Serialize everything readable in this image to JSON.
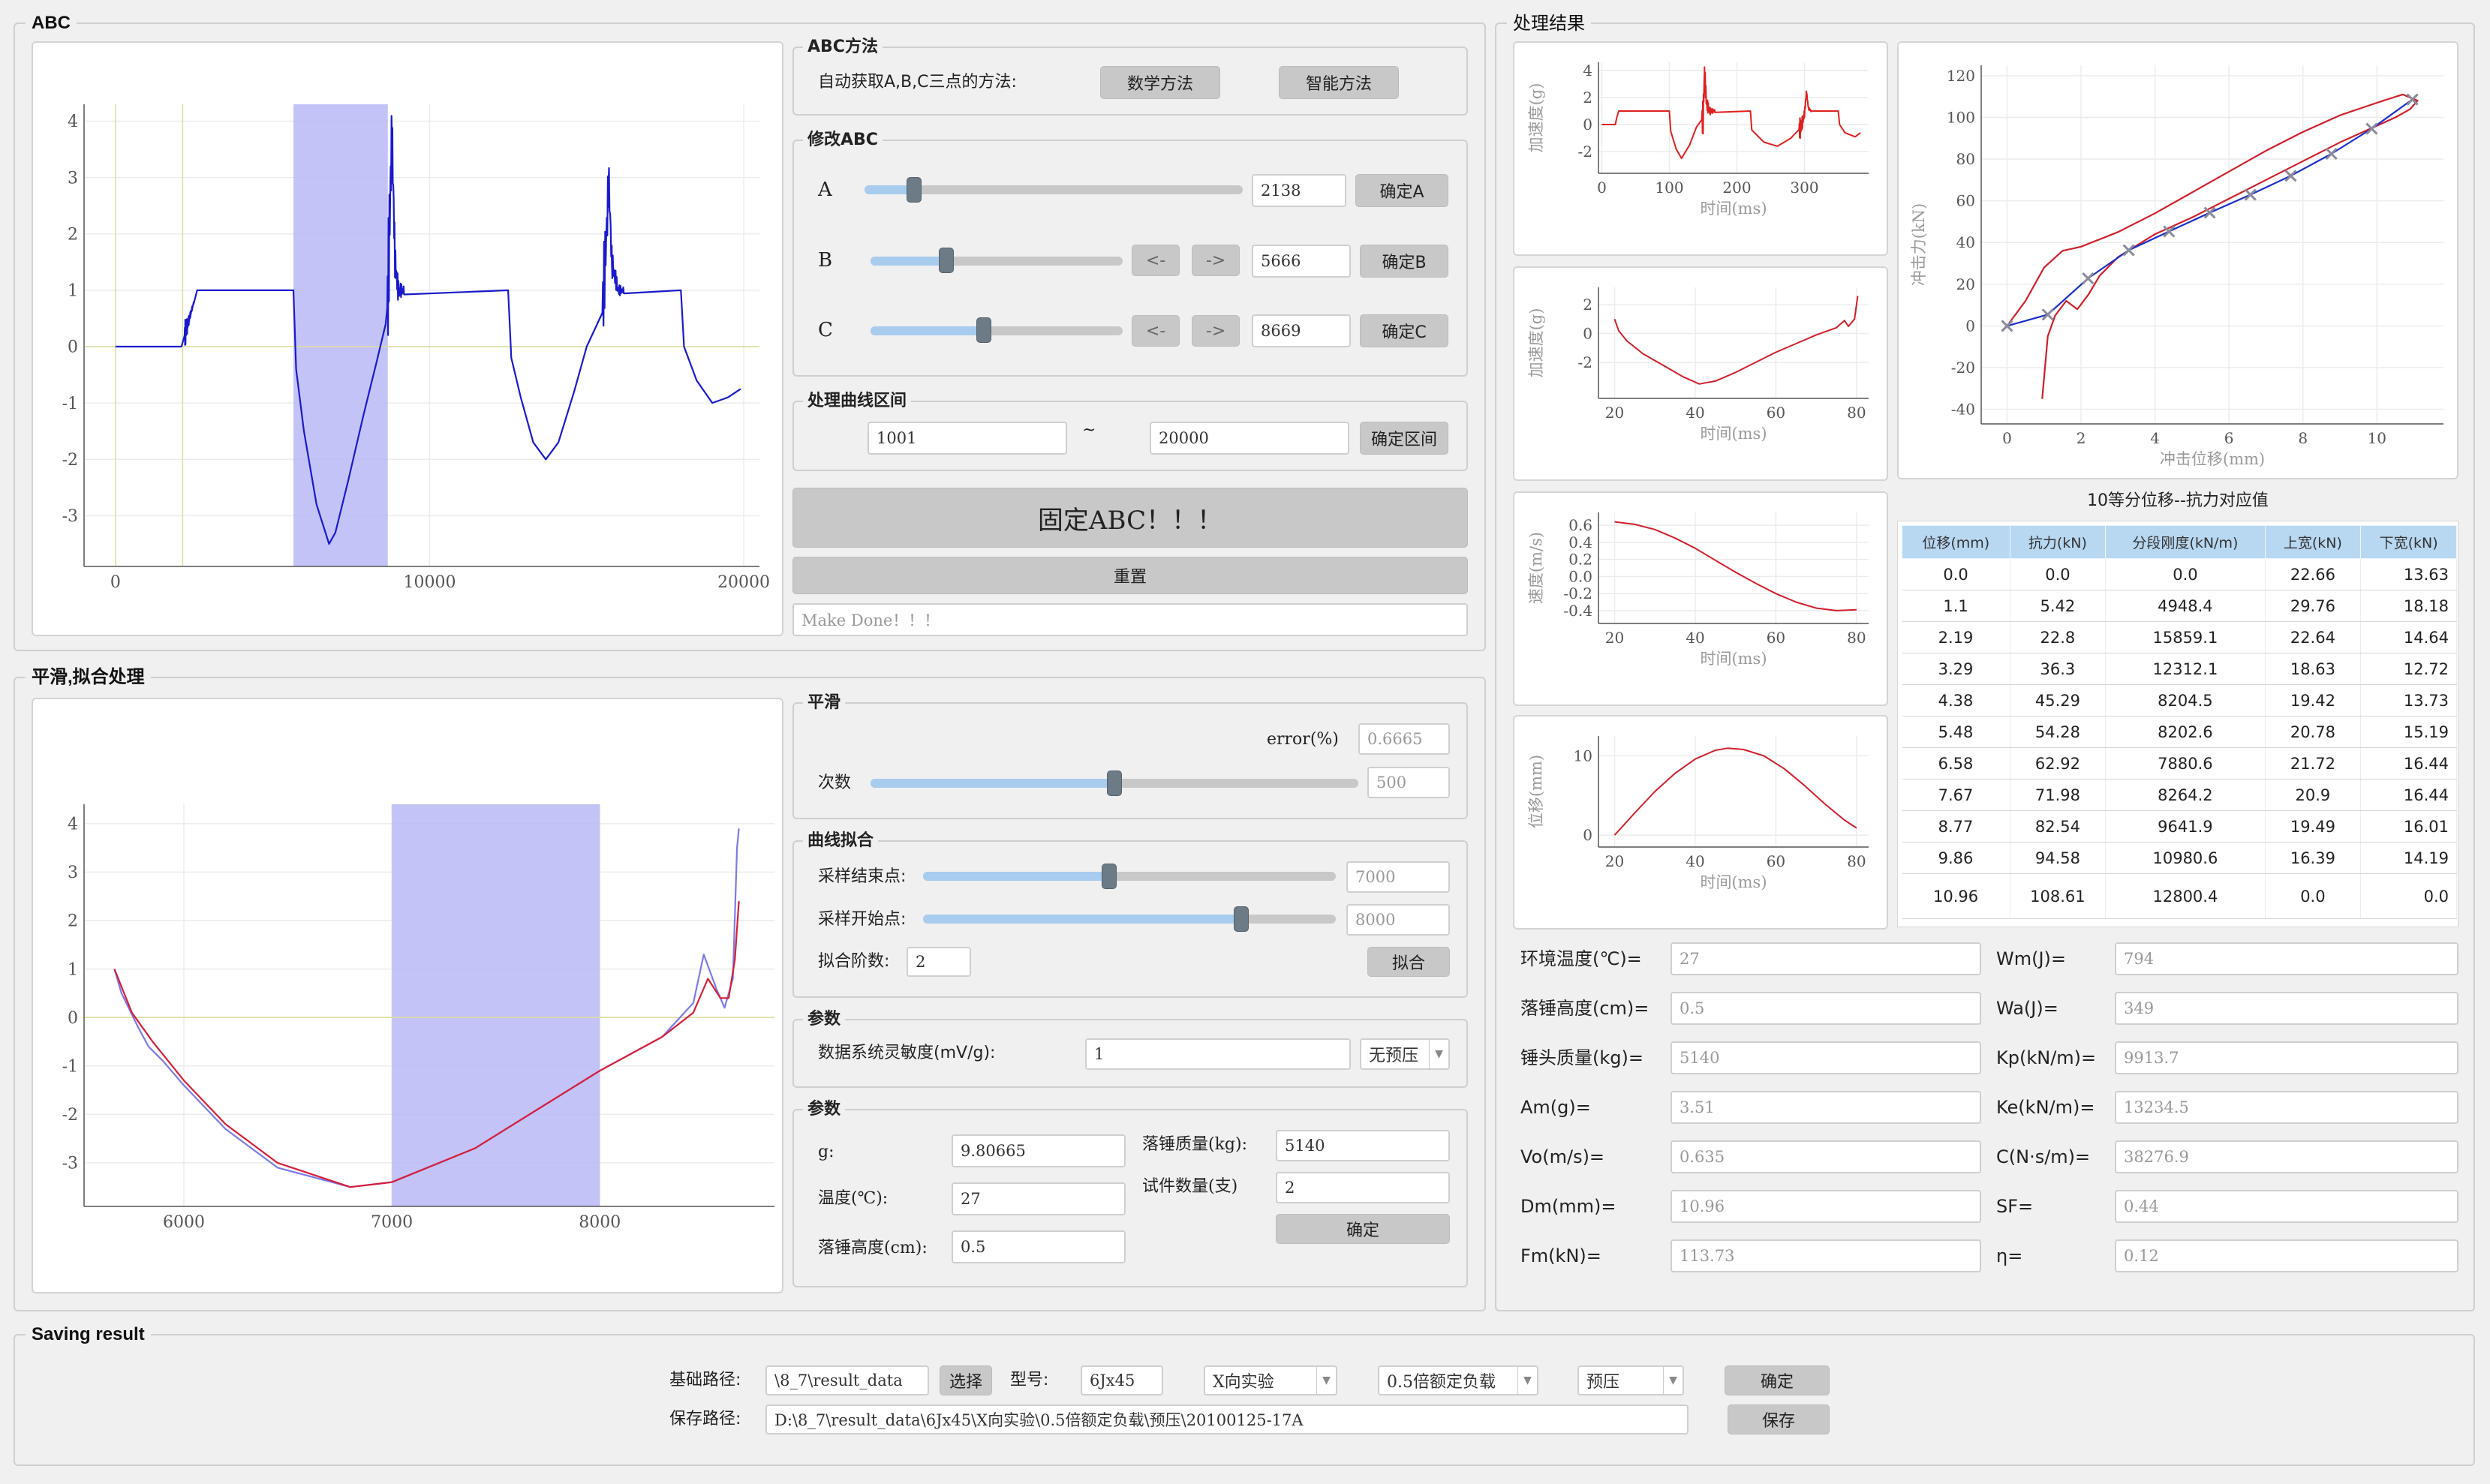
{
  "groups": {
    "abc": "ABC",
    "smooth": "平滑,拟合处理",
    "result": "处理结果",
    "saving": "Saving result"
  },
  "abc_method": {
    "title": "ABC方法",
    "desc": "自动获取A,B,C三点的方法:",
    "math_btn": "数学方法",
    "smart_btn": "智能方法"
  },
  "modify_abc": {
    "title": "修改ABC",
    "rows": [
      {
        "label": "A",
        "value": "2138",
        "confirm": "确定A",
        "level": 0.13
      },
      {
        "label": "B",
        "value": "5666",
        "confirm": "确定B",
        "level": 0.3
      },
      {
        "label": "C",
        "value": "8669",
        "confirm": "确定C",
        "level": 0.45
      }
    ],
    "left": "<-",
    "right": "->"
  },
  "range": {
    "title": "处理曲线区间",
    "start": "1001",
    "sep": "~",
    "end": "20000",
    "confirm": "确定区间"
  },
  "fix_btn": "固定ABC！！！",
  "reset_btn": "重置",
  "status_text": "Make Done！！！",
  "smooth": {
    "title": "平滑",
    "error_label": "error(%)",
    "error_value": "0.6665",
    "count_label": "次数",
    "count_value": "500",
    "count_level": 0.5
  },
  "fit": {
    "title": "曲线拟合",
    "end_label": "采样结束点:",
    "end_value": "7000",
    "end_level": 0.45,
    "start_label": "采样开始点:",
    "start_value": "8000",
    "start_level": 0.77,
    "order_label": "拟合阶数:",
    "order_value": "2",
    "fit_btn": "拟合"
  },
  "params1": {
    "title": "参数",
    "sens_label": "数据系统灵敏度(mV/g):",
    "sens_value": "1",
    "preload": "无预压"
  },
  "params2": {
    "title": "参数",
    "g_label": "g:",
    "g_value": "9.80665",
    "temp_label": "温度(℃):",
    "temp_value": "27",
    "height_label": "落锤高度(cm):",
    "height_value": "0.5",
    "mass_label": "落锤质量(kg):",
    "mass_value": "5140",
    "count_label": "试件数量(支)",
    "count_value": "2",
    "confirm": "确定"
  },
  "results_table": {
    "title": "10等分位移--抗力对应值",
    "headers": [
      "位移(mm)",
      "抗力(kN)",
      "分段刚度(kN/m)",
      "上宽(kN)",
      "下宽(kN)"
    ],
    "rows": [
      [
        "0.0",
        "0.0",
        "0.0",
        "22.66",
        "13.63"
      ],
      [
        "1.1",
        "5.42",
        "4948.4",
        "29.76",
        "18.18"
      ],
      [
        "2.19",
        "22.8",
        "15859.1",
        "22.64",
        "14.64"
      ],
      [
        "3.29",
        "36.3",
        "12312.1",
        "18.63",
        "12.72"
      ],
      [
        "4.38",
        "45.29",
        "8204.5",
        "19.42",
        "13.73"
      ],
      [
        "5.48",
        "54.28",
        "8202.6",
        "20.78",
        "15.19"
      ],
      [
        "6.58",
        "62.92",
        "7880.6",
        "21.72",
        "16.44"
      ],
      [
        "7.67",
        "71.98",
        "8264.2",
        "20.9",
        "16.44"
      ],
      [
        "8.77",
        "82.54",
        "9641.9",
        "19.49",
        "16.01"
      ],
      [
        "9.86",
        "94.58",
        "10980.6",
        "16.39",
        "14.19"
      ],
      [
        "10.96",
        "108.61",
        "12800.4",
        "0.0",
        "0.0"
      ]
    ]
  },
  "results_fields": {
    "left": [
      {
        "label": "环境温度(℃)=",
        "value": "27"
      },
      {
        "label": "落锤高度(cm)=",
        "value": "0.5"
      },
      {
        "label": "锤头质量(kg)=",
        "value": "5140"
      },
      {
        "label": "Am(g)=",
        "value": "3.51"
      },
      {
        "label": "Vo(m/s)=",
        "value": "0.635"
      },
      {
        "label": "Dm(mm)=",
        "value": "10.96"
      },
      {
        "label": "Fm(kN)=",
        "value": "113.73"
      }
    ],
    "right": [
      {
        "label": "Wm(J)=",
        "value": "794"
      },
      {
        "label": "Wa(J)=",
        "value": "349"
      },
      {
        "label": "Kp(kN/m)=",
        "value": "9913.7"
      },
      {
        "label": "Ke(kN/m)=",
        "value": "13234.5"
      },
      {
        "label": "C(N·s/m)=",
        "value": "38276.9"
      },
      {
        "label": "SF=",
        "value": "0.44"
      },
      {
        "label": "η=",
        "value": "0.12"
      }
    ]
  },
  "saving": {
    "base_label": "基础路径:",
    "base_value": "\\8_7\\result_data",
    "choose_btn": "选择",
    "model_label": "型号:",
    "model_value": "6Jx45",
    "direction": "X向实验",
    "load": "0.5倍额定负载",
    "preload": "预压",
    "confirm_btn": "确定",
    "save_label": "保存路径:",
    "save_value": "D:\\8_7\\result_data\\6Jx45\\X向实验\\0.5倍额定负载\\预压\\20100125-17A",
    "save_btn": "保存"
  },
  "chart_data": [
    {
      "id": "abc_signal",
      "type": "line",
      "title": "",
      "xlabel": "",
      "ylabel": "",
      "xlim": [
        -1000,
        20500
      ],
      "ylim": [
        -3.9,
        4.3
      ],
      "xticks": [
        0,
        10000,
        20000
      ],
      "yticks": [
        -3,
        -2,
        -1,
        0,
        1,
        2,
        3,
        4
      ],
      "highlight": [
        5666,
        8669
      ],
      "vlines": [
        0,
        2138
      ],
      "color": "#1a1acd",
      "points": [
        [
          0,
          0
        ],
        [
          2100,
          0
        ],
        [
          2300,
          0.4
        ],
        [
          2600,
          1.0
        ],
        [
          5666,
          1.0
        ],
        [
          5750,
          -0.4
        ],
        [
          6000,
          -1.5
        ],
        [
          6400,
          -2.8
        ],
        [
          6800,
          -3.5
        ],
        [
          7000,
          -3.3
        ],
        [
          7400,
          -2.4
        ],
        [
          7900,
          -1.2
        ],
        [
          8300,
          -0.3
        ],
        [
          8600,
          0.4
        ],
        [
          8669,
          0.8
        ],
        [
          8730,
          2.3
        ],
        [
          8800,
          3.8
        ],
        [
          8900,
          1.5
        ],
        [
          9000,
          1.0
        ],
        [
          12500,
          1.0
        ],
        [
          12600,
          -0.2
        ],
        [
          12900,
          -0.9
        ],
        [
          13300,
          -1.7
        ],
        [
          13700,
          -2.0
        ],
        [
          14100,
          -1.7
        ],
        [
          14600,
          -0.8
        ],
        [
          15000,
          0
        ],
        [
          15500,
          0.6
        ],
        [
          15650,
          2.2
        ],
        [
          15700,
          3.0
        ],
        [
          15800,
          1.5
        ],
        [
          16000,
          1.0
        ],
        [
          18000,
          1.0
        ],
        [
          18100,
          0
        ],
        [
          18500,
          -0.6
        ],
        [
          19000,
          -1.0
        ],
        [
          19500,
          -0.9
        ],
        [
          19900,
          -0.75
        ]
      ],
      "noise": [
        [
          2200,
          2500,
          0.3
        ],
        [
          8650,
          9200,
          1.2
        ],
        [
          15500,
          16200,
          0.9
        ]
      ]
    },
    {
      "id": "smooth_fit",
      "type": "line",
      "title": "",
      "xlabel": "",
      "ylabel": "",
      "xlim": [
        5520,
        8840
      ],
      "ylim": [
        -3.9,
        4.4
      ],
      "xticks": [
        6000,
        7000,
        8000
      ],
      "yticks": [
        -3,
        -2,
        -1,
        0,
        1,
        2,
        3,
        4
      ],
      "highlight": [
        7000,
        8000
      ],
      "series": [
        {
          "color": "#7b7be8",
          "points": [
            [
              5666,
              1.0
            ],
            [
              5700,
              0.5
            ],
            [
              5780,
              -0.2
            ],
            [
              5830,
              -0.6
            ],
            [
              5900,
              -0.9
            ],
            [
              6000,
              -1.4
            ],
            [
              6200,
              -2.3
            ],
            [
              6450,
              -3.1
            ],
            [
              6800,
              -3.5
            ],
            [
              7000,
              -3.4
            ],
            [
              7400,
              -2.7
            ],
            [
              7700,
              -1.9
            ],
            [
              8000,
              -1.1
            ],
            [
              8300,
              -0.4
            ],
            [
              8450,
              0.3
            ],
            [
              8500,
              1.3
            ],
            [
              8560,
              0.6
            ],
            [
              8600,
              0.2
            ],
            [
              8640,
              0.8
            ],
            [
              8660,
              3.5
            ],
            [
              8669,
              3.9
            ]
          ]
        },
        {
          "color": "#d61f3a",
          "points": [
            [
              5666,
              1.0
            ],
            [
              5750,
              0.1
            ],
            [
              5850,
              -0.5
            ],
            [
              6000,
              -1.3
            ],
            [
              6200,
              -2.2
            ],
            [
              6450,
              -3.0
            ],
            [
              6800,
              -3.5
            ],
            [
              7000,
              -3.4
            ],
            [
              7400,
              -2.7
            ],
            [
              7700,
              -1.9
            ],
            [
              8000,
              -1.1
            ],
            [
              8300,
              -0.4
            ],
            [
              8450,
              0.1
            ],
            [
              8520,
              0.8
            ],
            [
              8580,
              0.4
            ],
            [
              8620,
              0.4
            ],
            [
              8650,
              1.2
            ],
            [
              8669,
              2.4
            ]
          ]
        }
      ]
    },
    {
      "id": "accel_full",
      "type": "line",
      "xlabel": "时间(ms)",
      "ylabel": "加速度(g)",
      "xlim": [
        -5,
        395
      ],
      "ylim": [
        -3.6,
        4.6
      ],
      "xticks": [
        0,
        100,
        200,
        300
      ],
      "yticks": [
        -2,
        0,
        2,
        4
      ],
      "color": "#e02020",
      "points": [
        [
          0,
          0
        ],
        [
          20,
          0
        ],
        [
          22,
          0.5
        ],
        [
          25,
          1
        ],
        [
          100,
          1
        ],
        [
          102,
          -0.5
        ],
        [
          110,
          -1.8
        ],
        [
          118,
          -2.5
        ],
        [
          130,
          -1.5
        ],
        [
          140,
          -0.2
        ],
        [
          150,
          0.5
        ],
        [
          152,
          3.9
        ],
        [
          155,
          1.5
        ],
        [
          160,
          1
        ],
        [
          220,
          1
        ],
        [
          222,
          -0.4
        ],
        [
          240,
          -1.3
        ],
        [
          260,
          -1.6
        ],
        [
          280,
          -1.0
        ],
        [
          295,
          -0.2
        ],
        [
          300,
          0.8
        ],
        [
          303,
          2.4
        ],
        [
          306,
          1.2
        ],
        [
          310,
          1
        ],
        [
          350,
          1
        ],
        [
          352,
          0
        ],
        [
          360,
          -0.6
        ],
        [
          375,
          -0.9
        ],
        [
          383,
          -0.6
        ]
      ],
      "noise": [
        [
          148,
          168,
          1.6
        ],
        [
          292,
          310,
          1.0
        ]
      ]
    },
    {
      "id": "accel_seg",
      "type": "line",
      "xlabel": "时间(ms)",
      "ylabel": "加速度(g)",
      "xlim": [
        16,
        83
      ],
      "ylim": [
        -4.5,
        3.2
      ],
      "xticks": [
        20,
        40,
        60,
        80
      ],
      "yticks": [
        -2,
        0,
        2
      ],
      "color": "#d01f2c",
      "points": [
        [
          20,
          1.0
        ],
        [
          21,
          0.2
        ],
        [
          23,
          -0.5
        ],
        [
          27,
          -1.4
        ],
        [
          32,
          -2.2
        ],
        [
          37,
          -3.0
        ],
        [
          41,
          -3.5
        ],
        [
          45,
          -3.3
        ],
        [
          50,
          -2.7
        ],
        [
          55,
          -2.0
        ],
        [
          60,
          -1.3
        ],
        [
          65,
          -0.7
        ],
        [
          70,
          -0.1
        ],
        [
          75,
          0.4
        ],
        [
          77,
          0.9
        ],
        [
          78,
          0.5
        ],
        [
          79.5,
          1.0
        ],
        [
          80.3,
          2.6
        ]
      ]
    },
    {
      "id": "velocity",
      "type": "line",
      "xlabel": "时间(ms)",
      "ylabel": "速度(m/s)",
      "xlim": [
        16,
        83
      ],
      "ylim": [
        -0.55,
        0.75
      ],
      "xticks": [
        20,
        40,
        60,
        80
      ],
      "yticks": [
        -0.4,
        -0.2,
        0.0,
        0.2,
        0.4,
        0.6
      ],
      "color": "#d01f2c",
      "points": [
        [
          20,
          0.64
        ],
        [
          25,
          0.61
        ],
        [
          30,
          0.55
        ],
        [
          35,
          0.45
        ],
        [
          40,
          0.33
        ],
        [
          45,
          0.19
        ],
        [
          50,
          0.05
        ],
        [
          55,
          -0.08
        ],
        [
          60,
          -0.2
        ],
        [
          65,
          -0.3
        ],
        [
          70,
          -0.37
        ],
        [
          75,
          -0.4
        ],
        [
          80,
          -0.39
        ]
      ]
    },
    {
      "id": "displacement",
      "type": "line",
      "xlabel": "时间(ms)",
      "ylabel": "位移(mm)",
      "xlim": [
        16,
        83
      ],
      "ylim": [
        -1.5,
        12.5
      ],
      "xticks": [
        20,
        40,
        60,
        80
      ],
      "yticks": [
        0,
        10
      ],
      "color": "#d01f2c",
      "points": [
        [
          20,
          0
        ],
        [
          25,
          2.8
        ],
        [
          30,
          5.5
        ],
        [
          35,
          7.8
        ],
        [
          40,
          9.6
        ],
        [
          45,
          10.7
        ],
        [
          48,
          10.96
        ],
        [
          52,
          10.8
        ],
        [
          57,
          10.0
        ],
        [
          62,
          8.4
        ],
        [
          67,
          6.3
        ],
        [
          72,
          4.0
        ],
        [
          77,
          1.9
        ],
        [
          80,
          0.9
        ]
      ]
    },
    {
      "id": "force_disp",
      "type": "line",
      "xlabel": "冲击位移(mm)",
      "ylabel": "冲击力(kN)",
      "xlim": [
        -0.7,
        11.8
      ],
      "ylim": [
        -47,
        125
      ],
      "xticks": [
        0,
        2,
        4,
        6,
        8,
        10
      ],
      "yticks": [
        -40,
        -20,
        0,
        20,
        40,
        60,
        80,
        100,
        120
      ],
      "series": [
        {
          "name": "loop",
          "color": "#d01f2c",
          "points": [
            [
              0,
              0
            ],
            [
              0.5,
              12
            ],
            [
              1,
              28
            ],
            [
              1.5,
              36
            ],
            [
              2,
              38
            ],
            [
              3,
              45
            ],
            [
              4,
              54
            ],
            [
              5,
              64
            ],
            [
              6,
              74
            ],
            [
              7,
              84
            ],
            [
              8,
              93
            ],
            [
              9,
              101
            ],
            [
              10,
              107
            ],
            [
              10.7,
              111
            ],
            [
              11.1,
              108
            ],
            [
              10.9,
              104
            ],
            [
              10.5,
              100
            ],
            [
              10,
              96
            ],
            [
              9,
              88
            ],
            [
              8,
              79
            ],
            [
              7,
              70
            ],
            [
              6,
              61
            ],
            [
              5,
              52
            ],
            [
              4,
              44
            ],
            [
              3,
              33
            ],
            [
              2.5,
              24
            ],
            [
              2.2,
              15
            ],
            [
              1.9,
              8
            ],
            [
              1.6,
              12
            ],
            [
              1.3,
              5
            ],
            [
              1.1,
              -5
            ],
            [
              0.95,
              -35
            ]
          ]
        },
        {
          "name": "fit",
          "color": "#1a2fcc",
          "points": [
            [
              0,
              0
            ],
            [
              1.1,
              5.42
            ],
            [
              2.19,
              22.8
            ],
            [
              3.29,
              36.3
            ],
            [
              4.38,
              45.29
            ],
            [
              5.48,
              54.28
            ],
            [
              6.58,
              62.92
            ],
            [
              7.67,
              71.98
            ],
            [
              8.77,
              82.54
            ],
            [
              9.86,
              94.58
            ],
            [
              10.96,
              108.61
            ]
          ]
        }
      ]
    }
  ]
}
